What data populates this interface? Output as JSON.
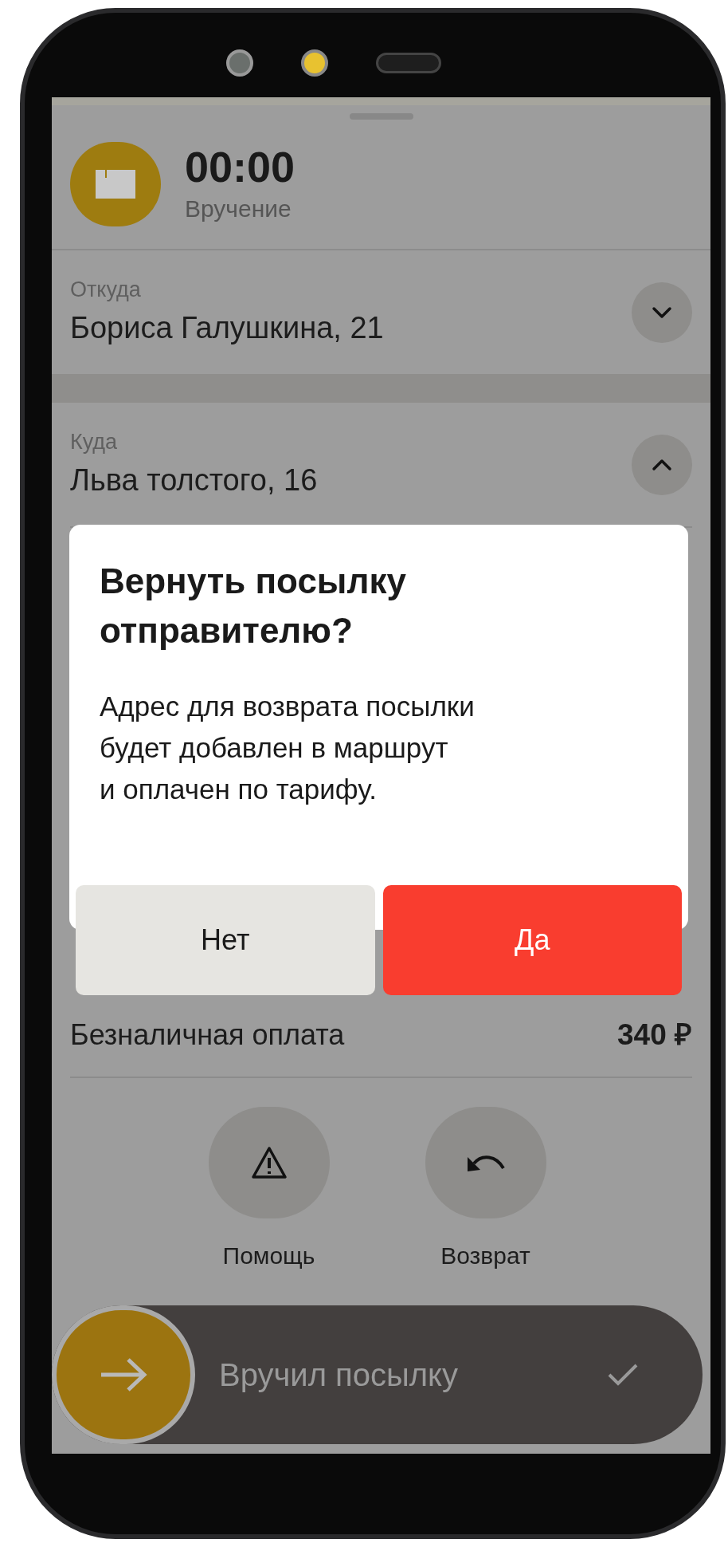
{
  "header": {
    "timer": "00:00",
    "status": "Вручение"
  },
  "route": [
    {
      "label": "Откуда",
      "address": "Бориса Галушкина, 21",
      "expanded": false
    },
    {
      "label": "Куда",
      "address": "Льва толстого, 16",
      "expanded": true
    }
  ],
  "dialog": {
    "title": "Вернуть посылку\nотправителю?",
    "body": "Адрес для возврата посылки\nбудет добавлен в маршрут\nи оплачен по тарифу.",
    "buttons": [
      {
        "label": "Нет",
        "kind": "secondary"
      },
      {
        "label": "Да",
        "kind": "primary"
      }
    ]
  },
  "payment": {
    "label": "Безналичная оплата",
    "amount": "340 ₽"
  },
  "actions": [
    {
      "label": "Помощь",
      "kind": "help"
    },
    {
      "label": "Возврат",
      "kind": "return"
    }
  ],
  "swipe": {
    "label": "Вручил посылку",
    "level": 0
  }
}
